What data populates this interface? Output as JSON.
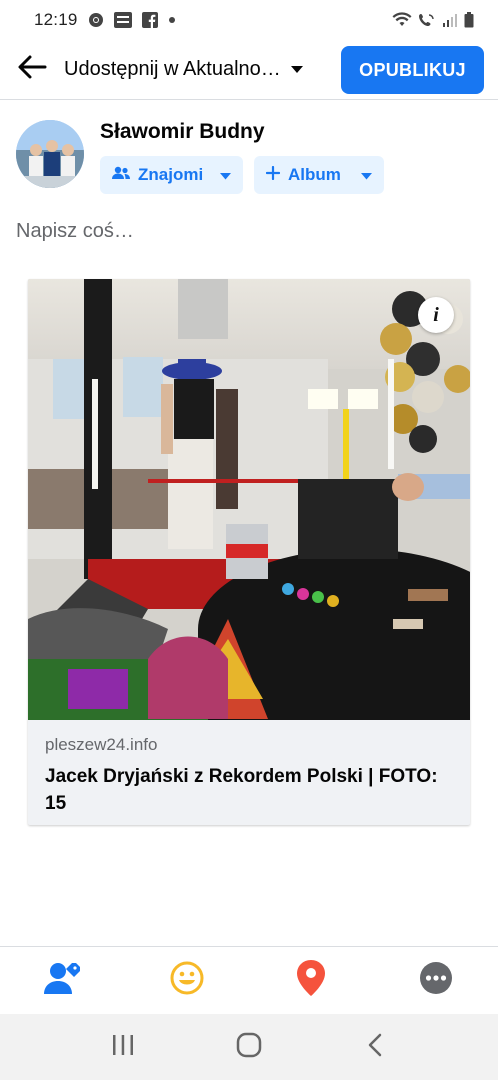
{
  "status_bar": {
    "time": "12:19",
    "icons": [
      "chrome-icon",
      "temu-icon",
      "facebook-icon",
      "dot-icon",
      "wifi-icon",
      "wifi-call-icon",
      "signal-icon",
      "battery-icon"
    ]
  },
  "header": {
    "back_icon": "arrow-left-icon",
    "audience_label": "Udostępnij w Aktualno…",
    "publish_label": "OPUBLIKUJ",
    "accent_color": "#1877f2"
  },
  "user": {
    "name": "Sławomir Budny",
    "privacy_label": "Znajomi",
    "album_label": "Album"
  },
  "composer": {
    "placeholder": "Napisz coś…"
  },
  "link_preview": {
    "domain": "pleszew24.info",
    "title": "Jacek Dryjański z Rekordem Polski | FOTO: 15",
    "info_label": "i"
  },
  "action_bar": {
    "items": [
      "tag-people-icon",
      "feeling-icon",
      "location-icon",
      "more-icon"
    ],
    "colors": {
      "tag": "#1877f2",
      "feeling": "#f7b928",
      "location": "#f5533d",
      "more": "#65676b"
    }
  },
  "system_nav": {
    "items": [
      "recent-apps-icon",
      "home-icon",
      "back-icon"
    ]
  }
}
